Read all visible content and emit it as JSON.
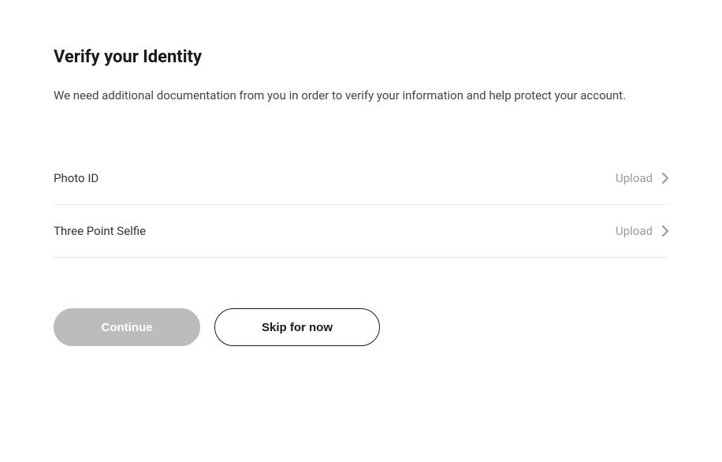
{
  "title": "Verify your Identity",
  "description": "We need additional documentation from you in order to verify your information and help protect your account.",
  "items": [
    {
      "label": "Photo ID",
      "action": "Upload"
    },
    {
      "label": "Three Point Selfie",
      "action": "Upload"
    }
  ],
  "buttons": {
    "continue": "Continue",
    "skip": "Skip for now"
  }
}
